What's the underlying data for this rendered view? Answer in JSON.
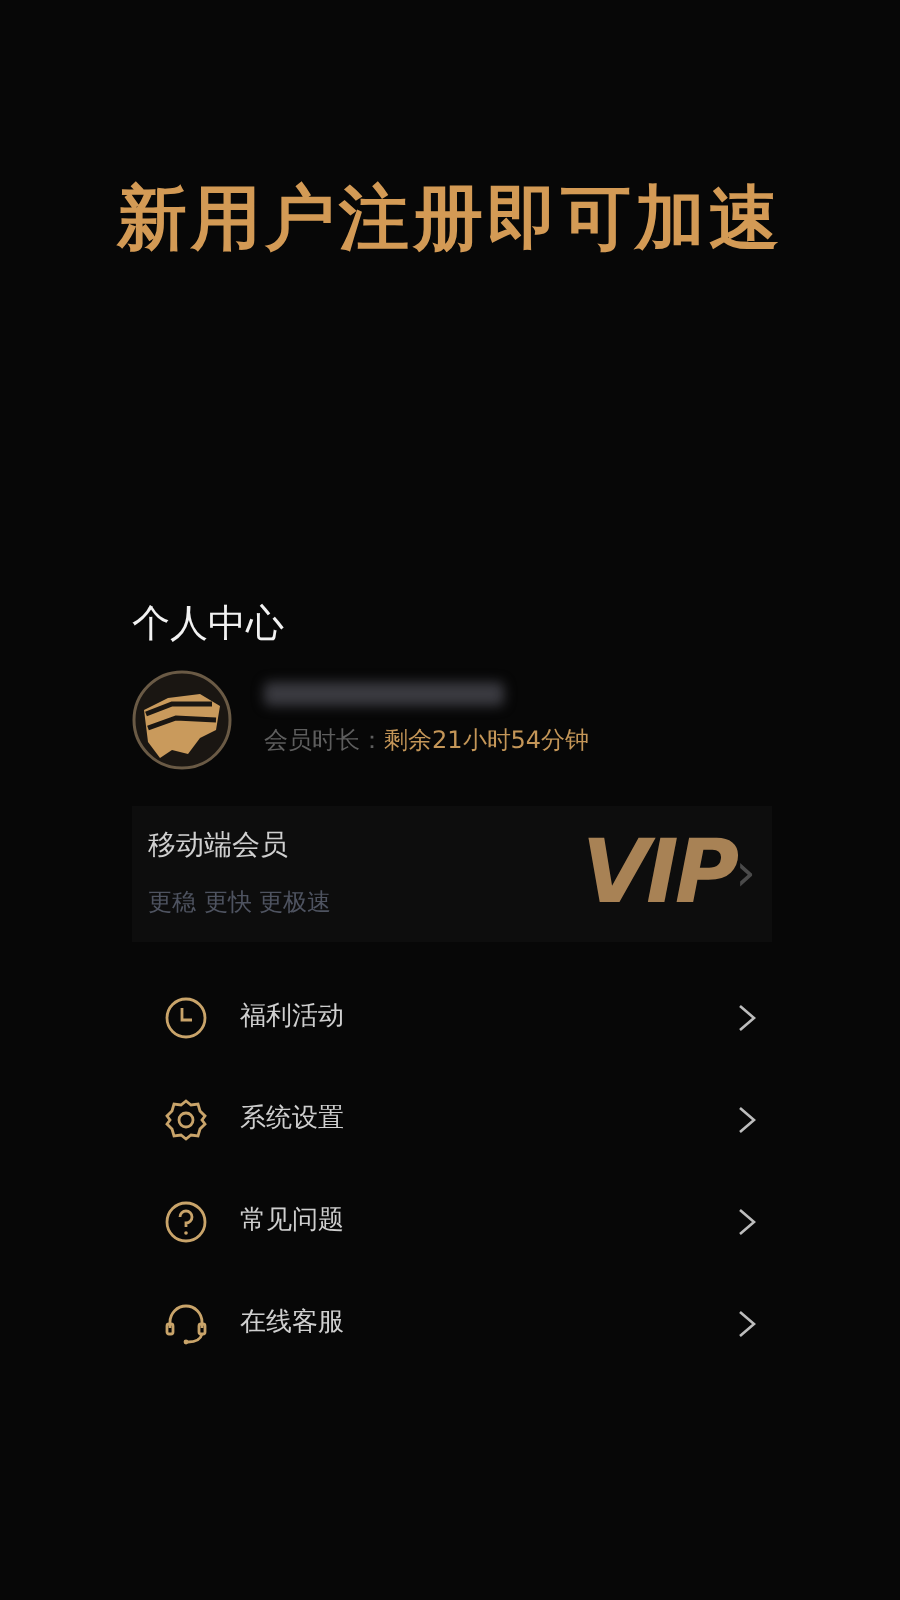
{
  "banner": {
    "title": "新用户注册即可加速"
  },
  "profile": {
    "heading": "个人中心",
    "duration_label": "会员时长：",
    "duration_value": "剩余21小时54分钟"
  },
  "membership": {
    "title": "移动端会员",
    "subtitle": "更稳 更快 更极速",
    "logo": "VIP",
    "chevron": "›"
  },
  "menu": [
    {
      "kind": "clock",
      "label": "福利活动"
    },
    {
      "kind": "gear",
      "label": "系统设置"
    },
    {
      "kind": "help",
      "label": "常见问题"
    },
    {
      "kind": "headset",
      "label": "在线客服"
    }
  ]
}
